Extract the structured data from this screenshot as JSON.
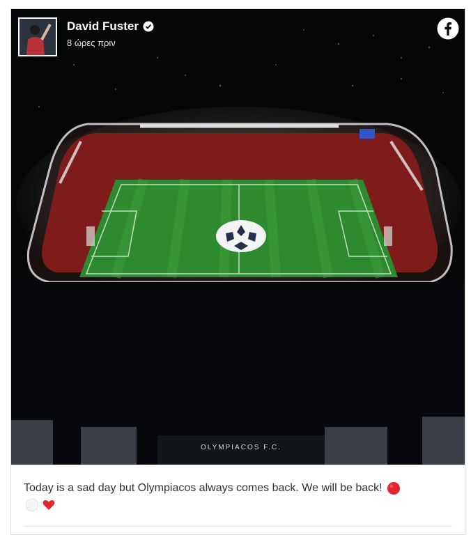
{
  "post": {
    "author": "David Fuster",
    "timestamp": "8 ώρες πριν",
    "verified_icon": "verified-badge-icon",
    "platform_icon": "facebook-icon",
    "caption": "Today is a sad day but Olympiacos always comes back. We will be back!",
    "caption_emojis": [
      "red-circle-icon",
      "white-circle-icon",
      "red-heart-icon"
    ],
    "stadium_sign": "OLYMPIACOS F.C.",
    "colors": {
      "pitch": "#2e8a2e",
      "crowd": "#8a1c1c",
      "night": "#050608",
      "caption_text": "#333333"
    }
  }
}
